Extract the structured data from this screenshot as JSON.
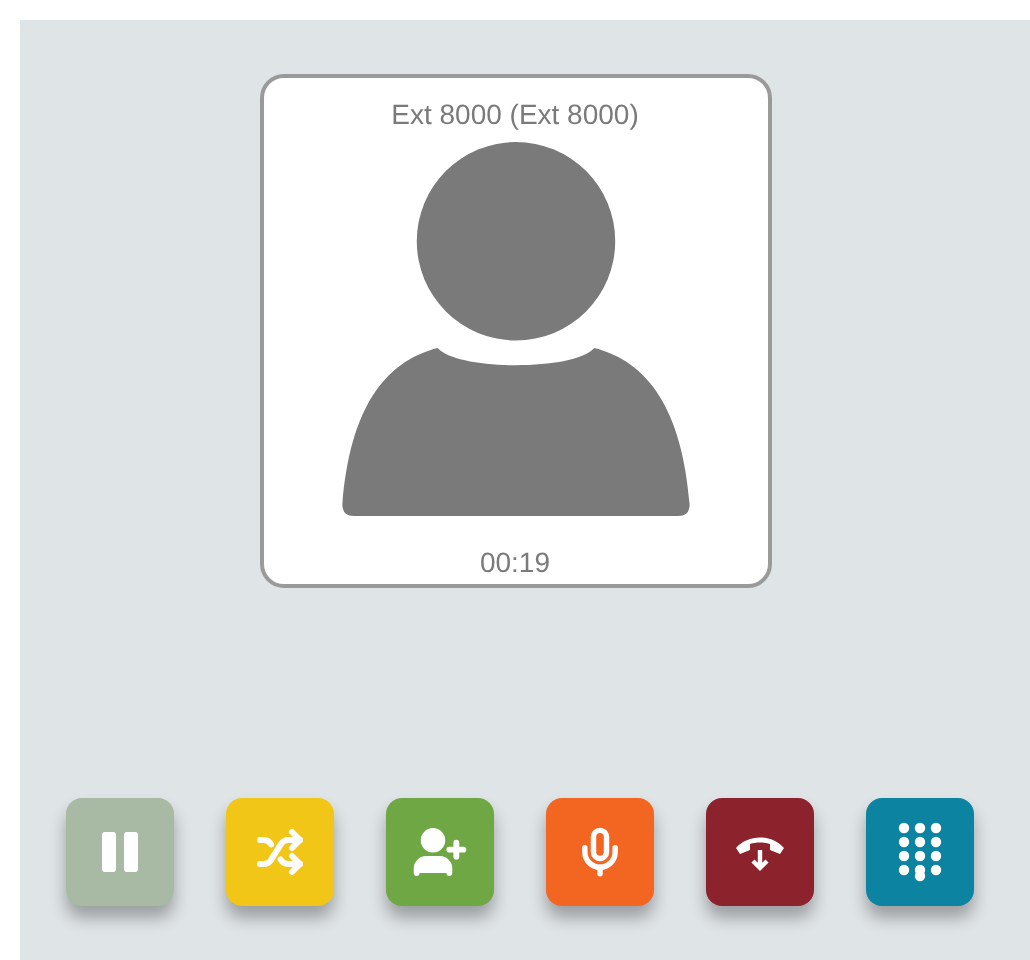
{
  "call": {
    "caller": "Ext 8000 (Ext 8000)",
    "duration": "00:19"
  },
  "buttons": [
    {
      "kind": "pause",
      "color": "#a8b9a4"
    },
    {
      "kind": "transfer",
      "color": "#f2c617"
    },
    {
      "kind": "add",
      "color": "#6fa744"
    },
    {
      "kind": "mic",
      "color": "#f26622"
    },
    {
      "kind": "hangup",
      "color": "#8c222c"
    },
    {
      "kind": "dialpad",
      "color": "#0c83a0"
    }
  ]
}
